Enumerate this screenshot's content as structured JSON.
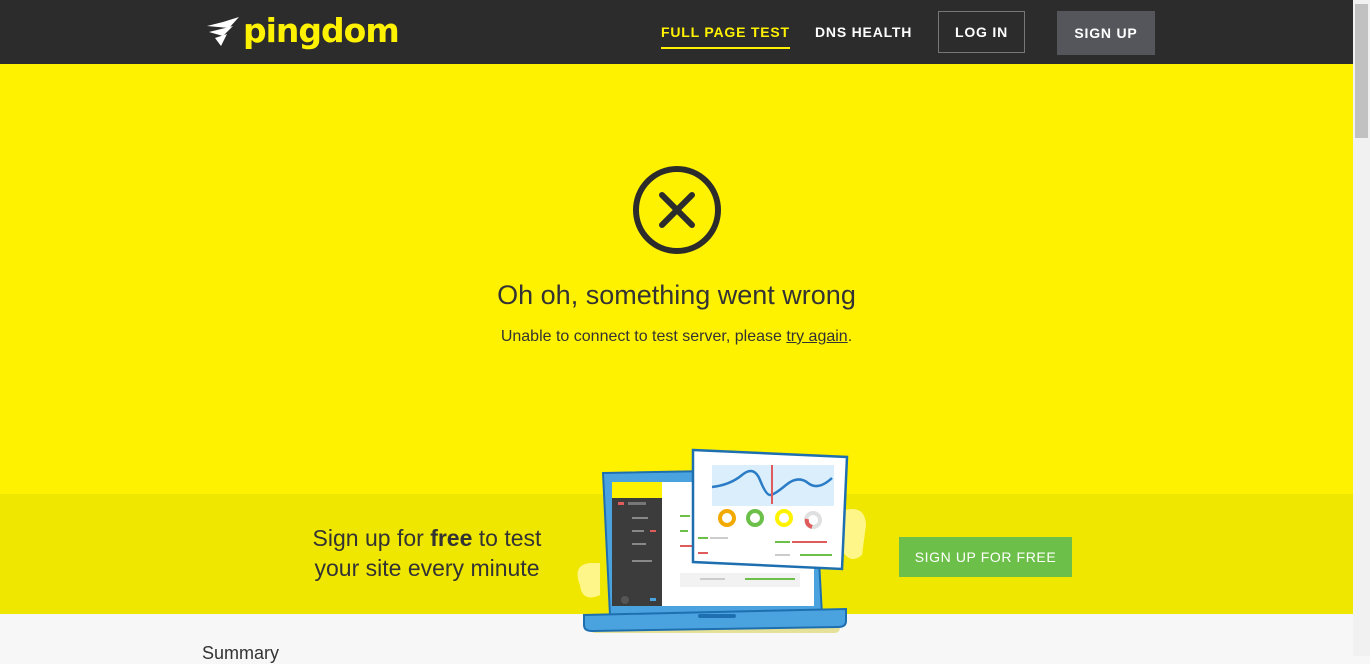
{
  "header": {
    "logo_text": "pingdom",
    "nav": {
      "full_page_test": "FULL PAGE TEST",
      "dns_health": "DNS HEALTH",
      "log_in": "LOG IN",
      "sign_up": "SIGN UP"
    },
    "colors": {
      "background": "#2c2c2c",
      "accent": "#fff200"
    }
  },
  "error": {
    "icon": "circle-x-icon",
    "title": "Oh oh, something went wrong",
    "message_prefix": "Unable to connect to test server, please ",
    "link_text": "try again",
    "message_suffix": "."
  },
  "promo": {
    "line1_prefix": "Sign up for ",
    "line1_bold": "free",
    "line1_suffix": " to test",
    "line2": "your site every minute",
    "button": "SIGN UP FOR FREE",
    "illustration": "laptop-dashboard-illustration"
  },
  "summary_heading": "Summary",
  "colors": {
    "hero": "#fff200",
    "promo": "#f0e700",
    "button_green": "#6cc04a"
  }
}
